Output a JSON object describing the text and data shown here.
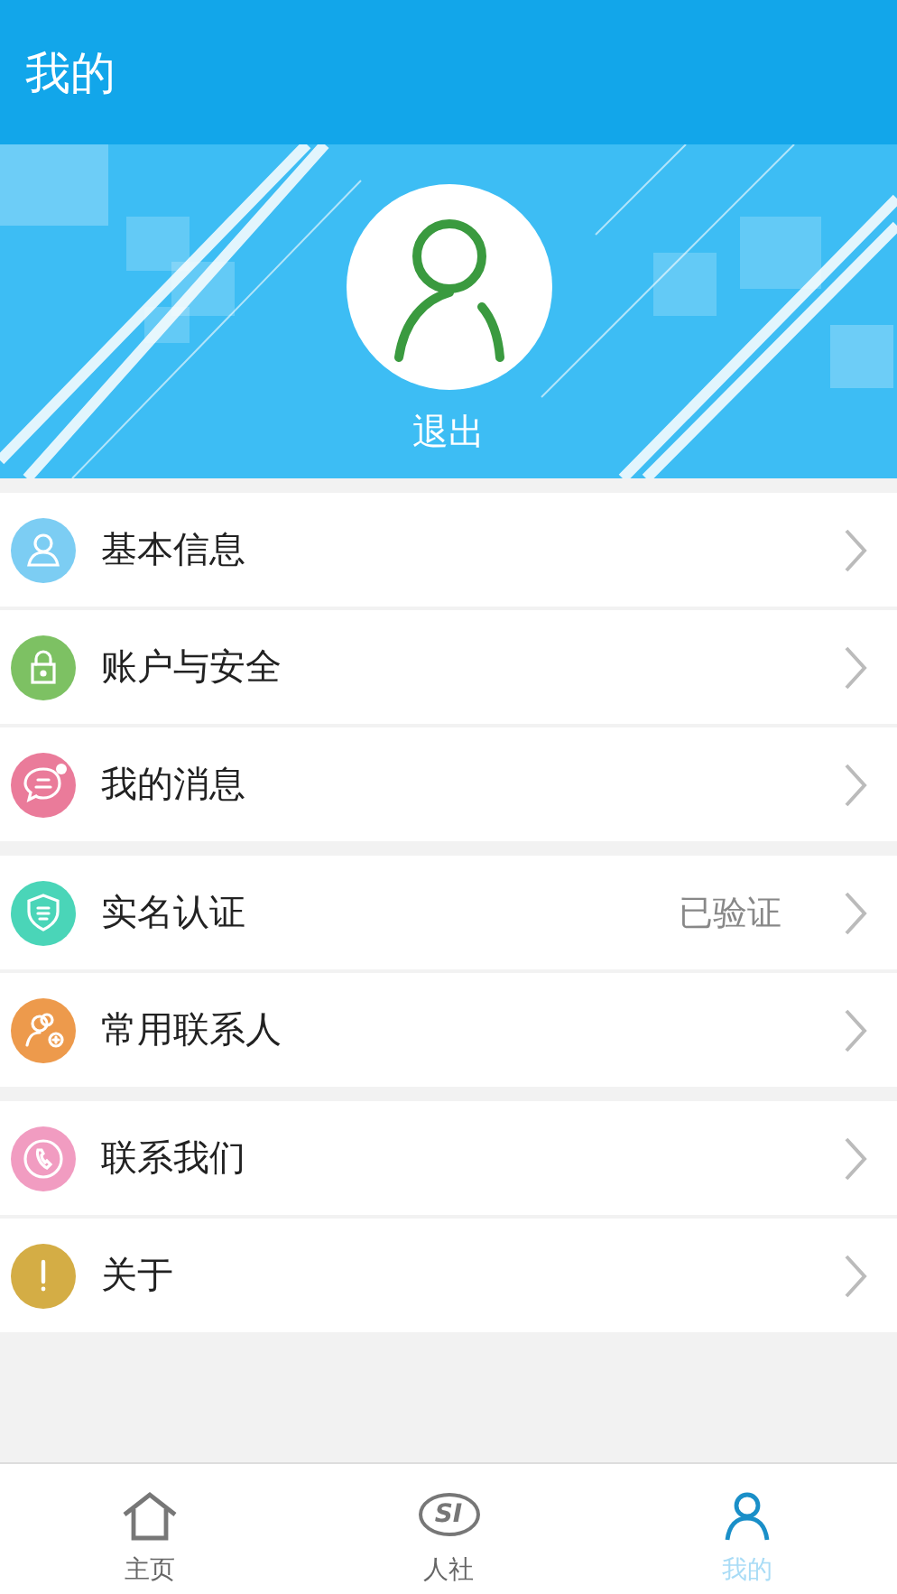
{
  "header": {
    "title": "我的"
  },
  "profile": {
    "logout_label": "退出"
  },
  "sections": [
    {
      "items": [
        {
          "kind": "person",
          "color": "#7ccdf3",
          "label": "基本信息"
        },
        {
          "kind": "lock",
          "color": "#7dc163",
          "label": "账户与安全"
        },
        {
          "kind": "message",
          "color": "#ea7b9a",
          "label": "我的消息"
        }
      ]
    },
    {
      "items": [
        {
          "kind": "shield",
          "color": "#4ad5b8",
          "label": "实名认证",
          "value": "已验证"
        },
        {
          "kind": "contacts",
          "color": "#ed9a4c",
          "label": "常用联系人"
        }
      ]
    },
    {
      "items": [
        {
          "kind": "phone",
          "color": "#f19cc1",
          "label": "联系我们"
        },
        {
          "kind": "info",
          "color": "#d4ad45",
          "label": "关于"
        }
      ]
    }
  ],
  "tabs": [
    {
      "kind": "home",
      "label": "主页",
      "selected": false
    },
    {
      "kind": "logo",
      "label": "人社",
      "icon_text": "SI",
      "selected": false
    },
    {
      "kind": "person",
      "label": "我的",
      "selected": true
    }
  ]
}
